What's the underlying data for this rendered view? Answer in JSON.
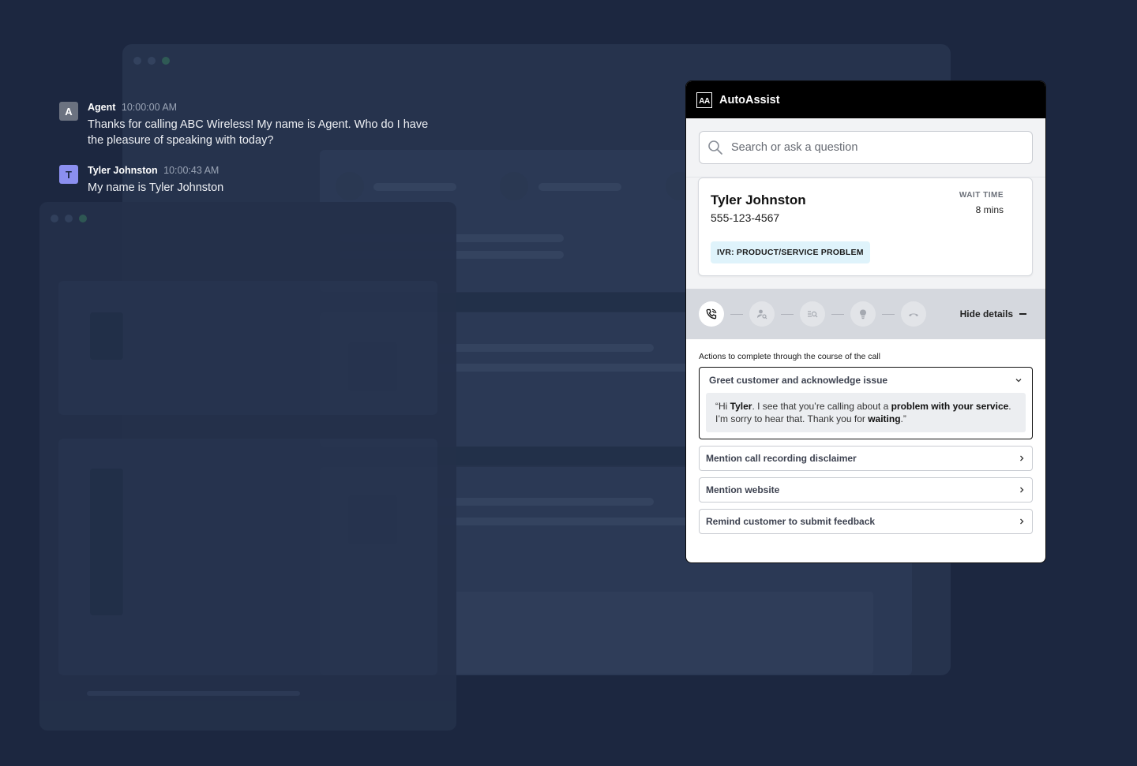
{
  "chat": {
    "messages": [
      {
        "initial": "A",
        "name": "Agent",
        "time": "10:00:00 AM",
        "text": "Thanks for calling ABC Wireless! My name is Agent. Who do I have the pleasure of speaking with today?"
      },
      {
        "initial": "T",
        "name": "Tyler Johnston",
        "time": "10:00:43 AM",
        "text": "My name is Tyler Johnston"
      }
    ]
  },
  "panel": {
    "logo_text": "AA",
    "title": "AutoAssist",
    "search_placeholder": "Search or ask a question",
    "customer": {
      "name": "Tyler Johnston",
      "phone": "555-123-4567",
      "wait_label": "WAIT TIME",
      "wait_value": "8 mins",
      "ivr_badge": "IVR: PRODUCT/SERVICE PROBLEM"
    },
    "steps": {
      "icons": [
        "phone-call-icon",
        "user-search-icon",
        "list-search-icon",
        "lightbulb-icon",
        "hang-up-icon"
      ],
      "hide_details_label": "Hide details"
    },
    "actions": {
      "caption": "Actions to complete through the course of the call",
      "open_item": {
        "label": "Greet customer and acknowledge issue",
        "script_parts": {
          "p1": "“Hi ",
          "b1": "Tyler",
          "p2": ". I see that you’re calling about a ",
          "b2": "problem with your service",
          "p3": ". I’m sorry to hear that. Thank you for ",
          "b3": "waiting",
          "p4": ".”"
        }
      },
      "items": [
        {
          "label": "Mention call recording disclaimer"
        },
        {
          "label": "Mention website"
        },
        {
          "label": "Remind customer to submit feedback"
        }
      ]
    },
    "colors": {
      "header_bg": "#000000",
      "badge_bg": "#dff3fb",
      "steps_bg": "#d5d8de",
      "page_bg": "#1c2740"
    }
  }
}
